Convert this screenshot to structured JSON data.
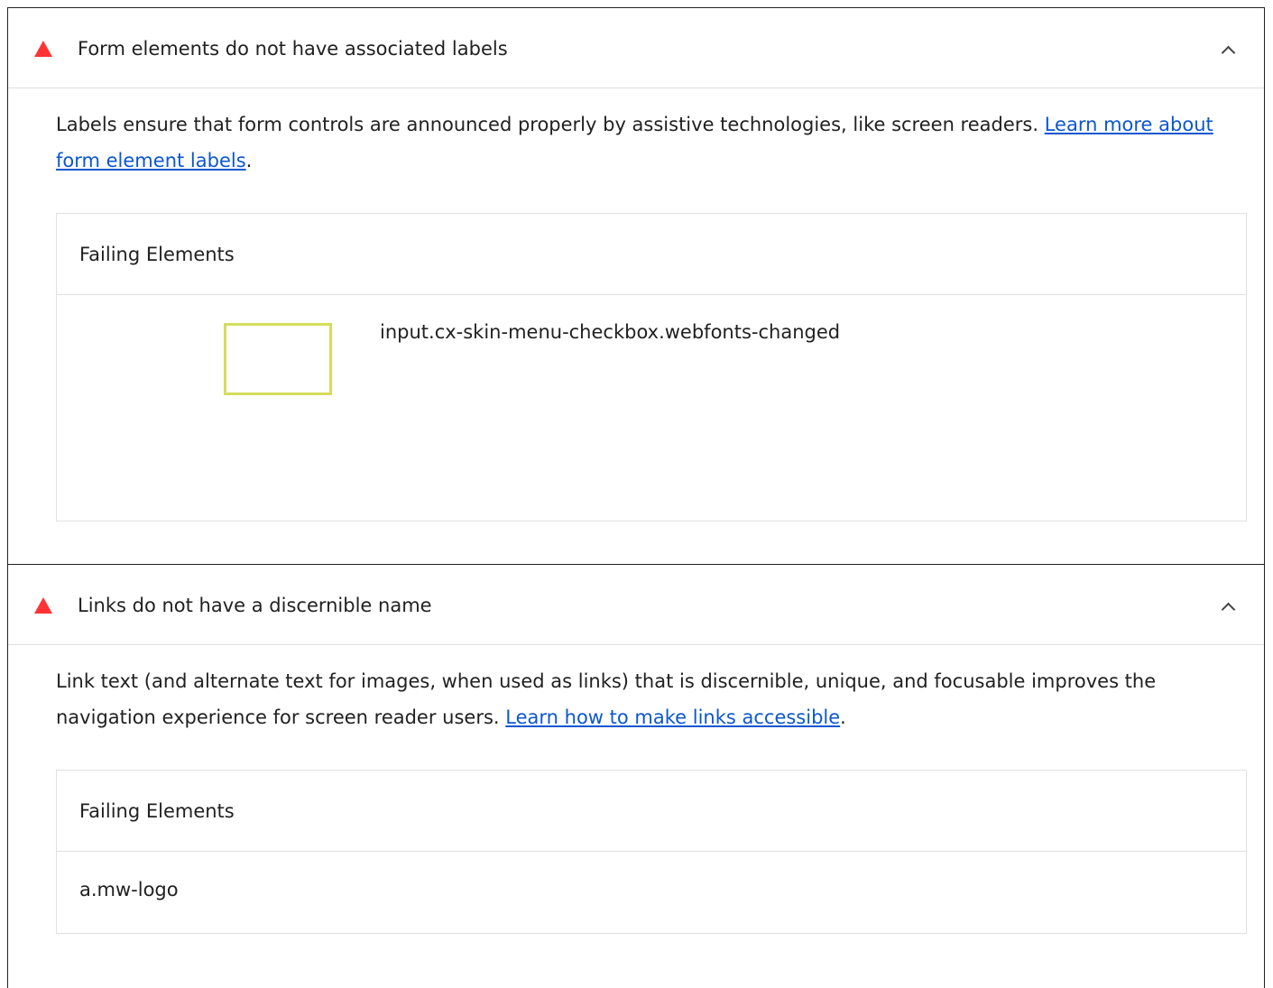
{
  "audits": [
    {
      "title": "Form elements do not have associated labels",
      "description_text": "Labels ensure that form controls are announced properly by assistive technologies, like screen readers. ",
      "link_text": "Learn more about form element labels",
      "description_suffix": ".",
      "failing_heading": "Failing Elements",
      "failing_elements": [
        {
          "selector": "input.cx-skin-menu-checkbox.webfonts-changed"
        }
      ]
    },
    {
      "title": "Links do not have a discernible name",
      "description_text": "Link text (and alternate text for images, when used as links) that is discernible, unique, and focusable improves the navigation experience for screen reader users. ",
      "link_text": "Learn how to make links accessible",
      "description_suffix": ".",
      "failing_heading": "Failing Elements",
      "failing_elements": [
        {
          "selector": "a.mw-logo"
        }
      ]
    }
  ],
  "colors": {
    "warning": "#ff3333",
    "link": "#0b57d0",
    "node_highlight": "#d4dd5c"
  },
  "icons": {
    "warning": "warning-triangle-icon",
    "collapse": "chevron-up-icon"
  }
}
